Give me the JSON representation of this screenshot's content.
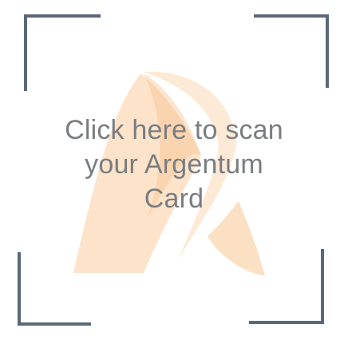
{
  "scanner": {
    "prompt": "Click here to scan your Argentum Card"
  },
  "colors": {
    "frame": "#5a6878",
    "logo": "#f9c28a",
    "text": "#7a7d80"
  },
  "icons": {
    "logo": "argentum-logo-icon"
  }
}
